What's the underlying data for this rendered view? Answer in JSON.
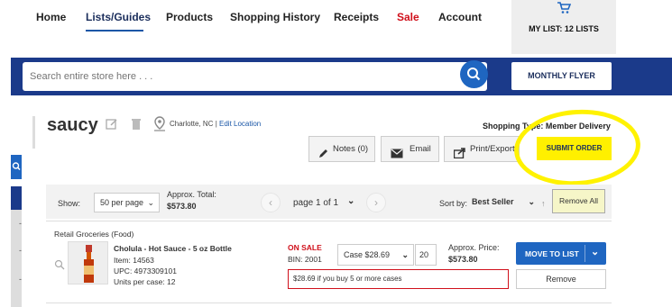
{
  "nav": {
    "items": [
      "Home",
      "Lists/Guides",
      "Products",
      "Shopping History",
      "Receipts",
      "Sale",
      "Account"
    ],
    "my_list": "MY LIST: 12 LISTS"
  },
  "search": {
    "placeholder": "Search entire store here . . .",
    "flyer_label": "MONTHLY FLYER"
  },
  "list": {
    "title": "saucy",
    "location": "Charlotte, NC",
    "location_sep": " | ",
    "edit_location": "Edit Location",
    "shopping_type": "Shopping Type: Member Delivery",
    "notes_label": "Notes (0)",
    "email_label": "Email",
    "print_label": "Print/Export",
    "submit_label": "SUBMIT ORDER"
  },
  "toolbar": {
    "show_label": "Show:",
    "per_page": "50 per page",
    "approx_total_label": "Approx. Total:",
    "approx_total_value": "$573.80",
    "page_label": "page 1 of 1",
    "sort_label": "Sort by:",
    "sort_value": "Best Seller",
    "sort_arrow": "↑",
    "remove_all": "Remove All"
  },
  "products": [
    {
      "category": "Retail Groceries (Food)",
      "name": "Cholula - Hot Sauce - 5 oz Bottle",
      "item": "Item: 14563",
      "upc": "UPC: 4973309101",
      "units": "Units per case: 12",
      "sale_badge": "ON SALE",
      "bin": "BIN: 2001",
      "unit_select": "Case $28.69",
      "quantity": "20",
      "approx_price_label": "Approx. Price:",
      "approx_price": "$573.80",
      "promo": "$28.69 if you buy 5 or more cases",
      "move_label": "MOVE TO LIST",
      "remove_label": "Remove"
    }
  ],
  "colors": {
    "brand_blue": "#1b3a8a",
    "accent_blue": "#1f66c1",
    "sale_red": "#d0101b",
    "highlight_yellow": "#fff200"
  },
  "icons": [
    "cart-icon",
    "search-icon",
    "edit-icon",
    "trash-icon",
    "location-pin-icon",
    "pencil-icon",
    "envelope-icon",
    "export-icon",
    "chevron-down-icon",
    "chevron-left-icon",
    "chevron-right-icon",
    "magnifier-icon"
  ]
}
